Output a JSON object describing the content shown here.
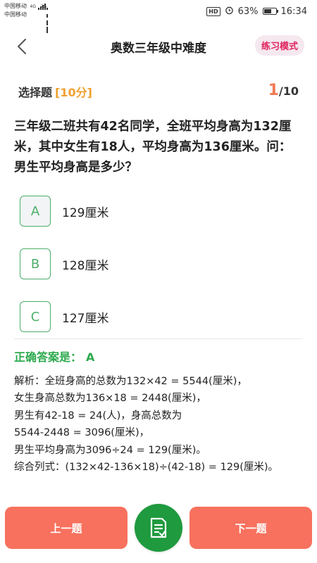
{
  "status_bar": {
    "carrier1": "中国移动",
    "carrier2": "中国移动",
    "network1": "4G",
    "network2": "2G",
    "hd": "HD",
    "battery_percent": "63%",
    "battery_level": 0.63,
    "time": "16:34"
  },
  "header": {
    "title": "奥数三年级中难度",
    "mode": "练习模式"
  },
  "question_meta": {
    "type": "选择题",
    "score": "[10分]",
    "current": "1",
    "total": "/10"
  },
  "question": {
    "text": "三年级二班共有42名同学，全班平均身高为132厘米，其中女生有18人，平均身高为136厘米。问：男生平均身高是多少？"
  },
  "options": [
    {
      "letter": "A",
      "text": "129厘米"
    },
    {
      "letter": "B",
      "text": "128厘米"
    },
    {
      "letter": "C",
      "text": "127厘米"
    }
  ],
  "answer": {
    "label": "正确答案是：",
    "value": "A"
  },
  "analysis": {
    "lines": [
      "解析：全班身高的总数为132×42 = 5544(厘米)，",
      "女生身高总数为136×18 = 2448(厘米)，",
      "男生有42-18 = 24(人)，身高总数为",
      "5544-2448 = 3096(厘米)，",
      "男生平均身高为3096÷24 = 129(厘米)。",
      "综合列式：(132×42-136×18)÷(42-18) = 129(厘米)。"
    ]
  },
  "bottom": {
    "prev_label": "上一题",
    "next_label": "下一题"
  },
  "colors": {
    "accent_green": "#4caf6a",
    "answer_green": "#2eaa4f",
    "button_coral": "#f7715e",
    "score_orange": "#f0a030",
    "mode_pink": "#e0245e"
  }
}
